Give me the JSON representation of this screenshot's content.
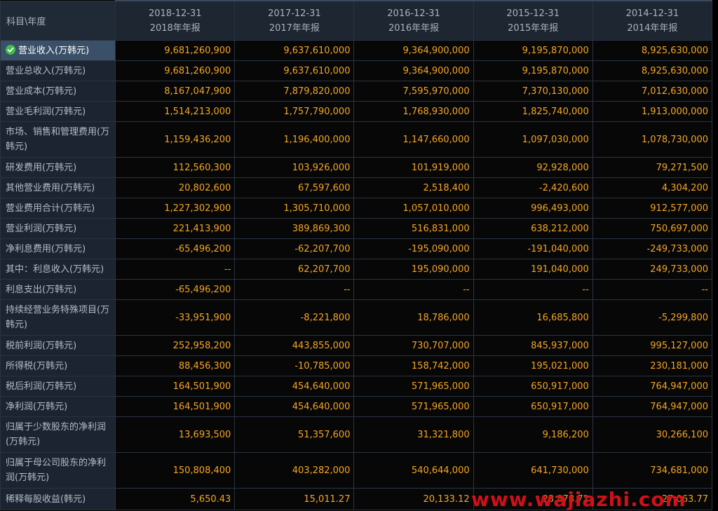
{
  "header": {
    "corner_label": "科目\\年度",
    "years": [
      {
        "date": "2018-12-31",
        "report": "2018年年报"
      },
      {
        "date": "2017-12-31",
        "report": "2017年年报"
      },
      {
        "date": "2016-12-31",
        "report": "2016年年报"
      },
      {
        "date": "2015-12-31",
        "report": "2015年年报"
      },
      {
        "date": "2014-12-31",
        "report": "2014年年报"
      }
    ]
  },
  "selected_row": 0,
  "rows": [
    {
      "label": "营业收入(万韩元)",
      "values": [
        "9,681,260,900",
        "9,637,610,000",
        "9,364,900,000",
        "9,195,870,000",
        "8,925,630,000"
      ]
    },
    {
      "label": "营业总收入(万韩元)",
      "values": [
        "9,681,260,900",
        "9,637,610,000",
        "9,364,900,000",
        "9,195,870,000",
        "8,925,630,000"
      ]
    },
    {
      "label": "营业成本(万韩元)",
      "values": [
        "8,167,047,900",
        "7,879,820,000",
        "7,595,970,000",
        "7,370,130,000",
        "7,012,630,000"
      ]
    },
    {
      "label": "营业毛利润(万韩元)",
      "values": [
        "1,514,213,000",
        "1,757,790,000",
        "1,768,930,000",
        "1,825,740,000",
        "1,913,000,000"
      ]
    },
    {
      "label": "市场、销售和管理费用(万韩元)",
      "values": [
        "1,159,436,200",
        "1,196,400,000",
        "1,147,660,000",
        "1,097,030,000",
        "1,078,730,000"
      ]
    },
    {
      "label": "研发费用(万韩元)",
      "values": [
        "112,560,300",
        "103,926,000",
        "101,919,000",
        "92,928,000",
        "79,271,500"
      ]
    },
    {
      "label": "其他营业费用(万韩元)",
      "values": [
        "20,802,600",
        "67,597,600",
        "2,518,400",
        "-2,420,600",
        "4,304,200"
      ]
    },
    {
      "label": "营业费用合计(万韩元)",
      "values": [
        "1,227,302,900",
        "1,305,710,000",
        "1,057,010,000",
        "996,493,000",
        "912,577,000"
      ]
    },
    {
      "label": "营业利润(万韩元)",
      "values": [
        "221,413,900",
        "389,869,300",
        "516,831,000",
        "638,212,000",
        "750,697,000"
      ]
    },
    {
      "label": "净利息费用(万韩元)",
      "values": [
        "-65,496,200",
        "-62,207,700",
        "-195,090,000",
        "-191,040,000",
        "-249,733,000"
      ]
    },
    {
      "label": "其中：利息收入(万韩元)",
      "values": [
        "--",
        "62,207,700",
        "195,090,000",
        "191,040,000",
        "249,733,000"
      ]
    },
    {
      "label": "利息支出(万韩元)",
      "values": [
        "-65,496,200",
        "--",
        "--",
        "--",
        "--"
      ]
    },
    {
      "label": "持续经营业务特殊项目(万韩元)",
      "values": [
        "-33,951,900",
        "-8,221,800",
        "18,786,000",
        "16,685,800",
        "-5,299,800"
      ]
    },
    {
      "label": "税前利润(万韩元)",
      "values": [
        "252,958,200",
        "443,855,000",
        "730,707,000",
        "845,937,000",
        "995,127,000"
      ]
    },
    {
      "label": "所得税(万韩元)",
      "values": [
        "88,456,300",
        "-10,785,000",
        "158,742,000",
        "195,021,000",
        "230,181,000"
      ]
    },
    {
      "label": "税后利润(万韩元)",
      "values": [
        "164,501,900",
        "454,640,000",
        "571,965,000",
        "650,917,000",
        "764,947,000"
      ]
    },
    {
      "label": "净利润(万韩元)",
      "values": [
        "164,501,900",
        "454,640,000",
        "571,965,000",
        "650,917,000",
        "764,947,000"
      ]
    },
    {
      "label": "归属于少数股东的净利润(万韩元)",
      "values": [
        "13,693,500",
        "51,357,600",
        "31,321,800",
        "9,186,200",
        "30,266,100"
      ]
    },
    {
      "label": "归属于母公司股东的净利润(万韩元)",
      "values": [
        "150,808,400",
        "403,282,000",
        "540,644,000",
        "641,730,000",
        "734,681,000"
      ]
    },
    {
      "label": "稀释每股收益(韩元)",
      "values": [
        "5,650.43",
        "15,011.27",
        "20,133.12",
        "23,878.72",
        "27,063.77"
      ]
    }
  ],
  "watermark": "www.wajiazhi.com",
  "colors": {
    "value_text": "#f5a623",
    "label_text": "#b3bcc6",
    "header_bg": "#1d2631",
    "selected_bg": "#3a5068",
    "check_icon": "#3fbf4a",
    "watermark": "#e2111b"
  },
  "icons": {
    "selected_marker": "check-icon"
  }
}
